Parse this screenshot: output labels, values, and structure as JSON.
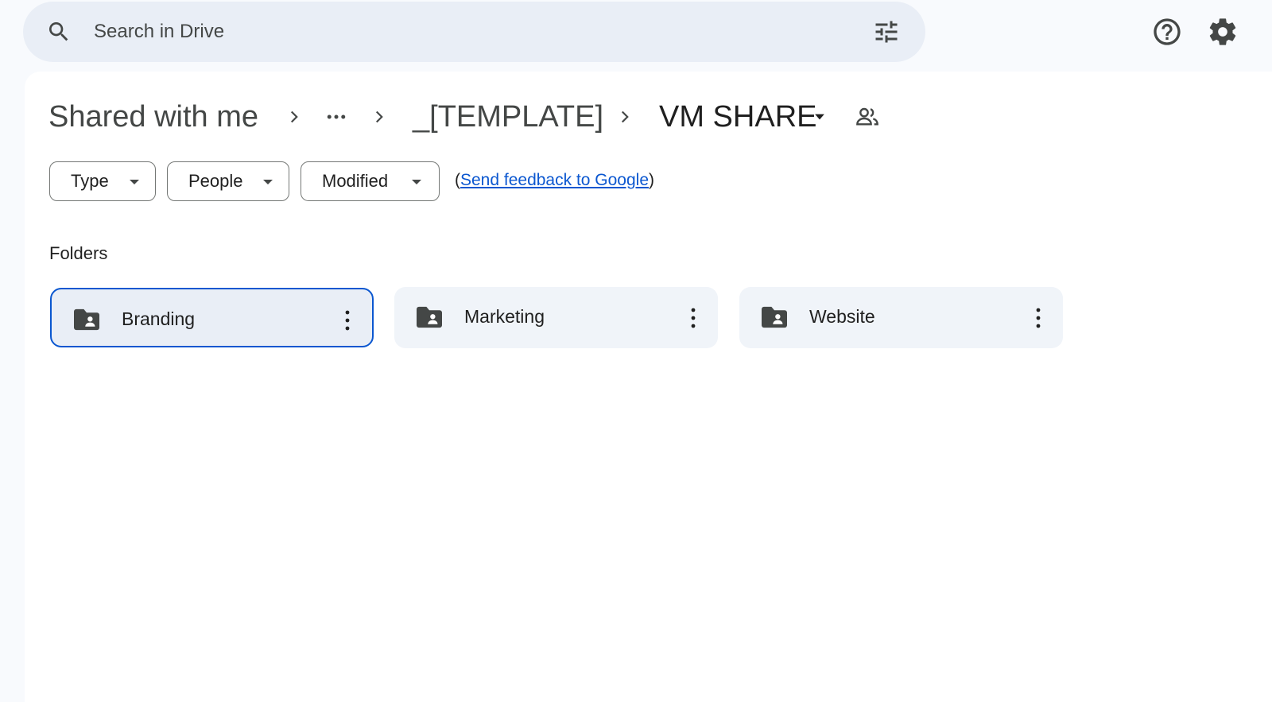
{
  "search": {
    "placeholder": "Search in Drive"
  },
  "breadcrumb": {
    "root": "Shared with me",
    "middle": "_[TEMPLATE]",
    "current": "VM SHARE"
  },
  "filters": {
    "type_label": "Type",
    "people_label": "People",
    "modified_label": "Modified"
  },
  "feedback": {
    "open_paren": "(",
    "link_text": "Send feedback to Google",
    "close_paren": ")"
  },
  "sections": {
    "folders_label": "Folders"
  },
  "folders": [
    {
      "name": "Branding",
      "selected": true
    },
    {
      "name": "Marketing",
      "selected": false
    },
    {
      "name": "Website",
      "selected": false
    }
  ],
  "colors": {
    "accent": "#0b57d0",
    "search_bg": "#e9eef6",
    "page_bg": "#f8fafd",
    "card_bg": "#f0f4f9",
    "icon": "#444746"
  }
}
